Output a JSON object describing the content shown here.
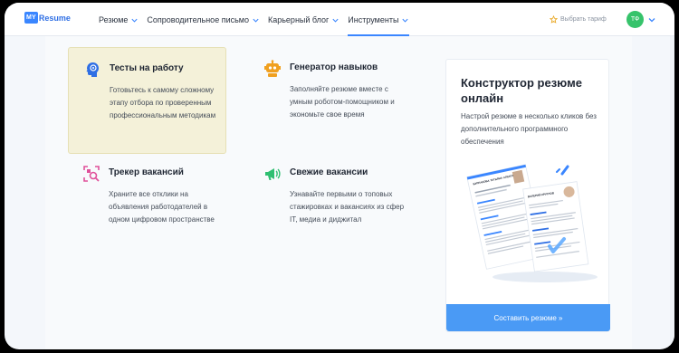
{
  "logo": {
    "badge": "MY",
    "text": "Resume"
  },
  "nav": {
    "items": [
      {
        "label": "Резюме"
      },
      {
        "label": "Сопроводительное письмо"
      },
      {
        "label": "Карьерный блог"
      },
      {
        "label": "Инструменты"
      }
    ]
  },
  "header": {
    "tariff_label": "Выбрать тариф",
    "avatar_initials": "ТФ"
  },
  "tools": [
    {
      "title": "Тесты на работу",
      "desc": "Готовьтесь к самому сложному этапу отбора по проверенным профессиональным методикам"
    },
    {
      "title": "Генератор навыков",
      "desc": "Заполняйте резюме вместе с умным роботом-помощником и экономьте свое время"
    },
    {
      "title": "Трекер вакансий",
      "desc": "Храните все отклики на объявления работодателей в одном цифровом пространстве"
    },
    {
      "title": "Свежие вакансии",
      "desc": "Узнавайте первыми о топовых стажировках и вакансиях из сфер IT, медиа и диджитал"
    }
  ],
  "promo": {
    "title": "Конструктор резюме онлайн",
    "desc": "Настрой резюме в несколько кликов без дополнительного программного обеспечения",
    "button": "Составить резюме »",
    "resume_names": [
      "БУРЛАКОВА ТАТЬЯНА АЛЕКСЕЕВНА",
      "ВАЛЕРИЙ КРУГЛОВ"
    ]
  },
  "colors": {
    "accent": "#3a86ff",
    "highlight": "#f4f1d9",
    "avatar": "#36c36b",
    "icon_blue": "#2f6fe4",
    "icon_orange": "#f0a020",
    "icon_pink": "#e0509a",
    "icon_green": "#2fbf71",
    "arrow": "#c8b96a"
  },
  "icons": [
    "head-icon",
    "robot-icon",
    "tracker-icon",
    "megaphone-icon",
    "star-icon",
    "chevron-down-icon",
    "arrow-right-icon"
  ]
}
